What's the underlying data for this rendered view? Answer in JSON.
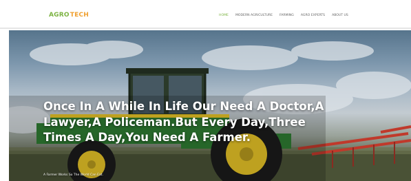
{
  "logo": {
    "agro": "AGRO",
    "tech": "TECH"
  },
  "nav": {
    "items": [
      {
        "label": "HOME",
        "active": true
      },
      {
        "label": "MODERN AGRICULTURE",
        "active": false
      },
      {
        "label": "FARMING",
        "active": false
      },
      {
        "label": "AGRO EXPERTS",
        "active": false
      },
      {
        "label": "ABOUT US",
        "active": false
      }
    ]
  },
  "hero": {
    "heading": "Once In A While In Life Our Need A Doctor,A Lawyer,A Policeman.But Every Day,Three Times A Day,You Need A Farmer.",
    "subtext": "A Farmer Works So The World Can Eat."
  },
  "colors": {
    "brand_green": "#7cb342",
    "brand_orange": "#f0a030",
    "tractor_green": "#2f7d32",
    "tractor_yellow": "#e8c528",
    "implement_red": "#c0392b"
  }
}
